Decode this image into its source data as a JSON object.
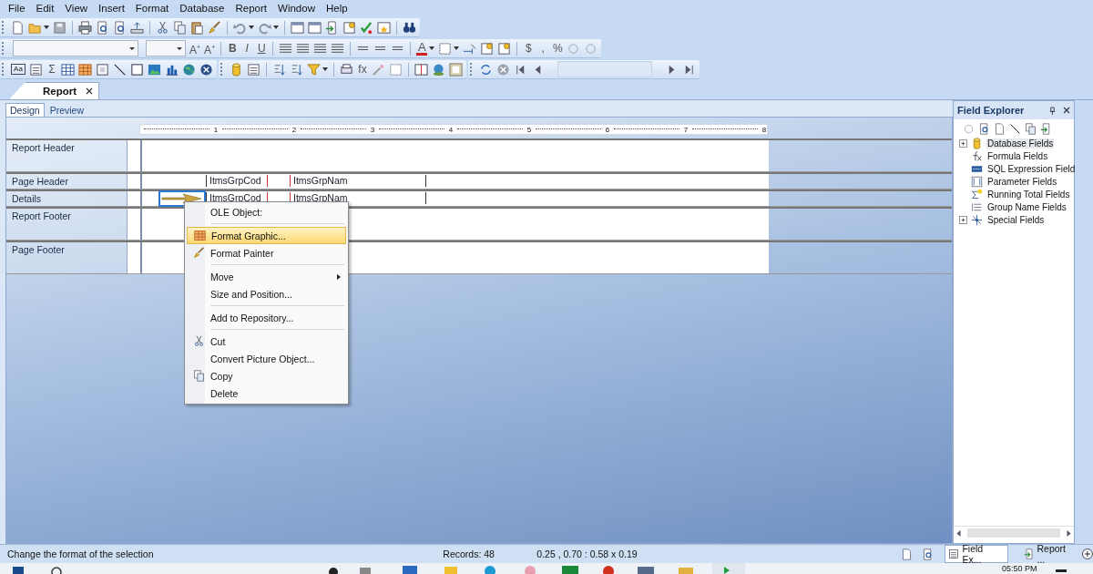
{
  "menu_bar": [
    {
      "label": "File"
    },
    {
      "label": "Edit"
    },
    {
      "label": "View"
    },
    {
      "label": "Insert"
    },
    {
      "label": "Format"
    },
    {
      "label": "Database"
    },
    {
      "label": "Report"
    },
    {
      "label": "Window"
    },
    {
      "label": "Help"
    }
  ],
  "formatting_toolbar": {
    "glyphs": [
      "A$^{+}$",
      "A$^{+}$",
      "B",
      "I",
      "U",
      "A",
      "$",
      ",",
      "%"
    ]
  },
  "insert_toolbar": {
    "glyphs": [
      "Aa",
      "Σ",
      "fx"
    ]
  },
  "document_tabs": [
    {
      "label": "Report",
      "selected": true
    }
  ],
  "view_tabs": [
    {
      "label": "Design",
      "selected": true
    },
    {
      "label": "Preview",
      "selected": false
    }
  ],
  "ruler": {
    "labels": [
      "1",
      "2",
      "3",
      "4",
      "5",
      "6",
      "7",
      "8"
    ]
  },
  "sections": [
    {
      "name": "Report Header"
    },
    {
      "name": "Page Header",
      "fields": [
        {
          "text": "ItmsGrpCod"
        },
        {
          "text": "ItmsGrpNam"
        }
      ]
    },
    {
      "name": "Details",
      "fields": [
        {
          "text": "ItmsGrpCod"
        },
        {
          "text": "ItmsGrpNam"
        }
      ],
      "ole_object": {
        "selected": true
      }
    },
    {
      "name": "Report Footer"
    },
    {
      "name": "Page Footer"
    }
  ],
  "context_menu": {
    "title": "OLE Object:",
    "items": [
      {
        "kind": "separator"
      },
      {
        "kind": "item",
        "label": "Format Graphic...",
        "selected": true
      },
      {
        "kind": "item",
        "label": "Format Painter",
        "selected": false
      },
      {
        "kind": "separator"
      },
      {
        "kind": "submenu",
        "label": "Move",
        "selected": false
      },
      {
        "kind": "item",
        "label": "Size and Position...",
        "selected": false
      },
      {
        "kind": "separator"
      },
      {
        "kind": "item",
        "label": "Add to Repository...",
        "selected": false
      },
      {
        "kind": "separator"
      },
      {
        "kind": "item",
        "label": "Cut",
        "selected": false
      },
      {
        "kind": "item",
        "label": "Convert Picture Object...",
        "selected": false
      },
      {
        "kind": "item",
        "label": "Copy",
        "selected": false
      },
      {
        "kind": "item",
        "label": "Delete",
        "selected": false
      }
    ]
  },
  "field_explorer": {
    "title": "Field Explorer",
    "items": [
      {
        "label": "Database Fields",
        "expanded": false,
        "selected": true
      },
      {
        "label": "Formula Fields",
        "selected": false
      },
      {
        "label": "SQL Expression Field",
        "selected": false
      },
      {
        "label": "Parameter Fields",
        "selected": false
      },
      {
        "label": "Running Total Fields",
        "selected": false
      },
      {
        "label": "Group Name Fields",
        "selected": false
      },
      {
        "label": "Special Fields",
        "expanded": false,
        "selected": false
      }
    ]
  },
  "status_bar": {
    "message": "Change the format of the selection",
    "records": "Records: 48",
    "position": "0.25 , 0.70 : 0.58 x 0.19",
    "panel_tabs": [
      {
        "label": "Field Ex...",
        "selected": true
      },
      {
        "label": "Report ...",
        "selected": false
      }
    ]
  },
  "taskbar": {
    "clock": "05:50 PM"
  }
}
